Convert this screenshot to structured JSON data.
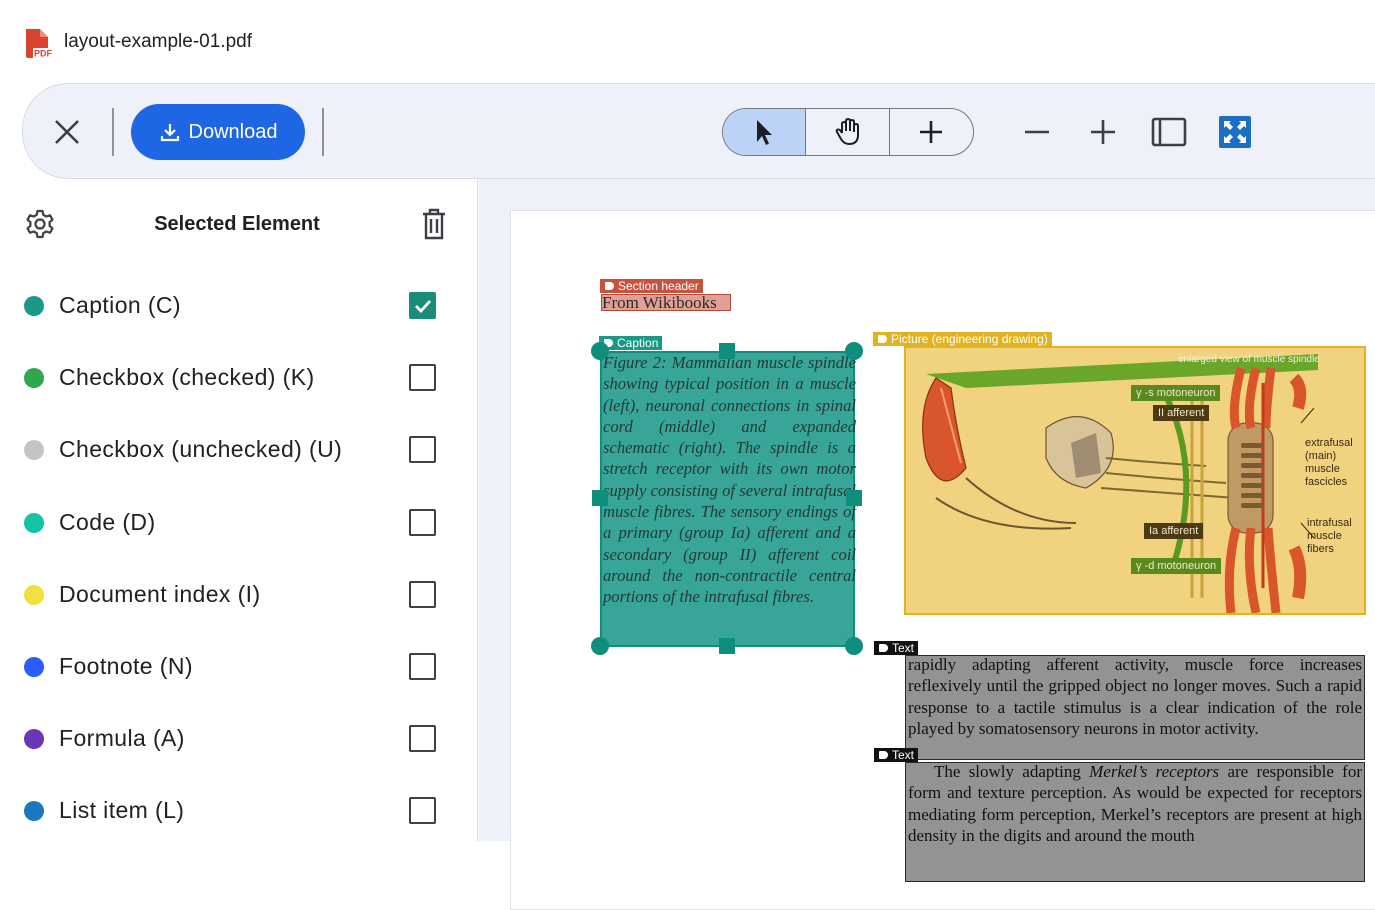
{
  "window": {
    "file_name": "layout-example-01.pdf",
    "pdf_icon_text": "PDF"
  },
  "toolbar": {
    "close_icon": "close-icon",
    "download_label": "Download",
    "tools": [
      "select-pointer",
      "pan-hand",
      "add"
    ],
    "active_tool": "select-pointer",
    "zoom_out_icon": "minus-icon",
    "zoom_in_icon": "plus-icon",
    "fit_page_icon": "fit-width-icon",
    "fit_screen_icon": "fit-screen-icon",
    "accent_color": "#1f66e5"
  },
  "sidebar": {
    "title": "Selected Element",
    "items": [
      {
        "label": "Caption (C)",
        "color": "#1a9a86",
        "checked": true
      },
      {
        "label": "Checkbox (checked) (K)",
        "color": "#2ea84a",
        "checked": false
      },
      {
        "label": "Checkbox (unchecked) (U)",
        "color": "#c4c4c4",
        "checked": false
      },
      {
        "label": "Code (D)",
        "color": "#14c3a6",
        "checked": false
      },
      {
        "label": "Document index (I)",
        "color": "#f0e040",
        "checked": false
      },
      {
        "label": "Footnote (N)",
        "color": "#2a5cff",
        "checked": false
      },
      {
        "label": "Formula (A)",
        "color": "#6a36b8",
        "checked": false
      },
      {
        "label": "List item (L)",
        "color": "#1a78c0",
        "checked": false
      }
    ]
  },
  "document": {
    "section_header": {
      "tag": "Section header",
      "text": "From Wikibooks",
      "color": "#c9523e"
    },
    "caption": {
      "tag": "Caption",
      "text": "Figure 2: Mammalian muscle spindle showing typical position in a muscle (left), neuronal connections in spinal cord (middle) and expanded schematic (right). The spindle is a stretch receptor with its own motor supply consisting of several intrafusal muscle fibres. The sensory endings of a primary (group Ia) afferent and a secondary (group II) afferent coil around the non-contractile central portions of the intrafusal fibres.",
      "color": "#1a9a86"
    },
    "picture": {
      "tag": "Picture (engineering drawing)",
      "color": "#e0b420",
      "labels": {
        "enlarged": "enlarged view of muscle spindle",
        "gamma_s": "γ -s motoneuron",
        "ii_afferent": "II afferent",
        "ia_afferent": "Ia afferent",
        "gamma_d": "γ -d motoneuron",
        "extrafusal": "extrafusal (main) muscle fascicles",
        "intrafusal": "intrafusal muscle fibers"
      }
    },
    "text_blocks": [
      {
        "tag": "Text",
        "text": "rapidly adapting afferent activity, muscle force increases reflexively until the gripped object no longer moves. Such a rapid response to a tactile stimulus is a clear indication of the role played by somatosensory neurons in motor activity."
      },
      {
        "tag": "Text",
        "text_before": "The slowly adapting ",
        "text_italic": "Merkel’s receptors",
        "text_after": " are responsible for form and texture perception. As would be expected for receptors mediating form perception, Merkel’s receptors are present at high density in the digits and around the mouth"
      }
    ]
  }
}
